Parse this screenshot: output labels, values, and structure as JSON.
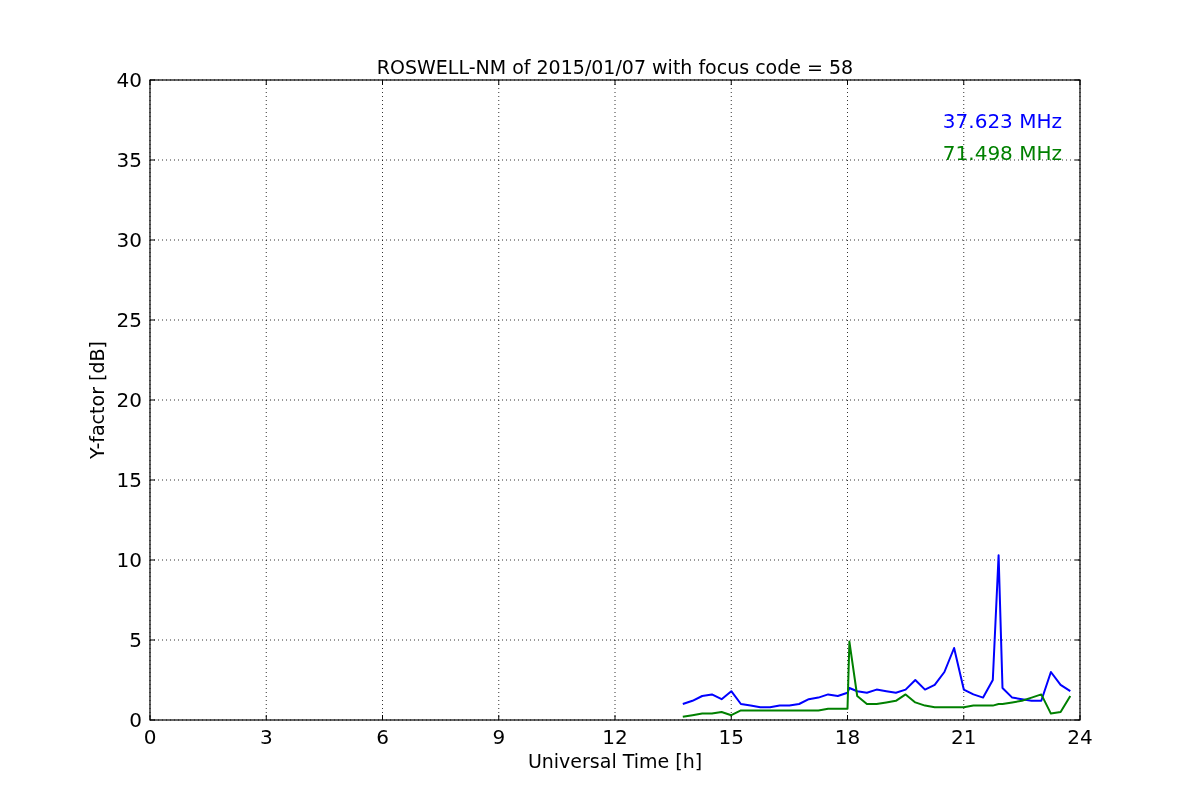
{
  "chart_data": {
    "type": "line",
    "title": "ROSWELL-NM of 2015/01/07 with focus code = 58",
    "xlabel": "Universal Time [h]",
    "ylabel": "Y-factor [dB]",
    "x": [
      13.75,
      14.0,
      14.25,
      14.5,
      14.75,
      15.0,
      15.25,
      15.5,
      15.75,
      16.0,
      16.25,
      16.5,
      16.75,
      17.0,
      17.25,
      17.5,
      17.75,
      18.0,
      18.05,
      18.25,
      18.5,
      18.75,
      19.0,
      19.25,
      19.5,
      19.75,
      20.0,
      20.25,
      20.5,
      20.75,
      21.0,
      21.25,
      21.5,
      21.75,
      21.9,
      22.0,
      22.25,
      22.5,
      22.75,
      23.0,
      23.25,
      23.5,
      23.75
    ],
    "series": [
      {
        "name": "37.623 MHz",
        "color": "#0000ff",
        "values": [
          1.0,
          1.2,
          1.5,
          1.6,
          1.3,
          1.8,
          1.0,
          0.9,
          0.8,
          0.8,
          0.9,
          0.9,
          1.0,
          1.3,
          1.4,
          1.6,
          1.5,
          1.7,
          2.0,
          1.8,
          1.7,
          1.9,
          1.8,
          1.7,
          1.9,
          2.5,
          1.9,
          2.2,
          3.0,
          4.5,
          1.9,
          1.6,
          1.4,
          2.5,
          10.3,
          2.0,
          1.4,
          1.3,
          1.2,
          1.2,
          3.0,
          2.2,
          1.8
        ]
      },
      {
        "name": "71.498 MHz",
        "color": "#008000",
        "values": [
          0.2,
          0.3,
          0.4,
          0.4,
          0.5,
          0.3,
          0.6,
          0.6,
          0.6,
          0.6,
          0.6,
          0.6,
          0.6,
          0.6,
          0.6,
          0.7,
          0.7,
          0.7,
          4.9,
          1.5,
          1.0,
          1.0,
          1.1,
          1.2,
          1.6,
          1.1,
          0.9,
          0.8,
          0.8,
          0.8,
          0.8,
          0.9,
          0.9,
          0.9,
          1.0,
          1.0,
          1.1,
          1.2,
          1.4,
          1.6,
          0.4,
          0.5,
          1.5
        ]
      }
    ],
    "grid": true,
    "xlim": [
      0,
      24
    ],
    "ylim": [
      0,
      40
    ],
    "xticks": [
      0,
      3,
      6,
      9,
      12,
      15,
      18,
      21,
      24
    ],
    "yticks": [
      0,
      5,
      10,
      15,
      20,
      25,
      30,
      35,
      40
    ]
  }
}
